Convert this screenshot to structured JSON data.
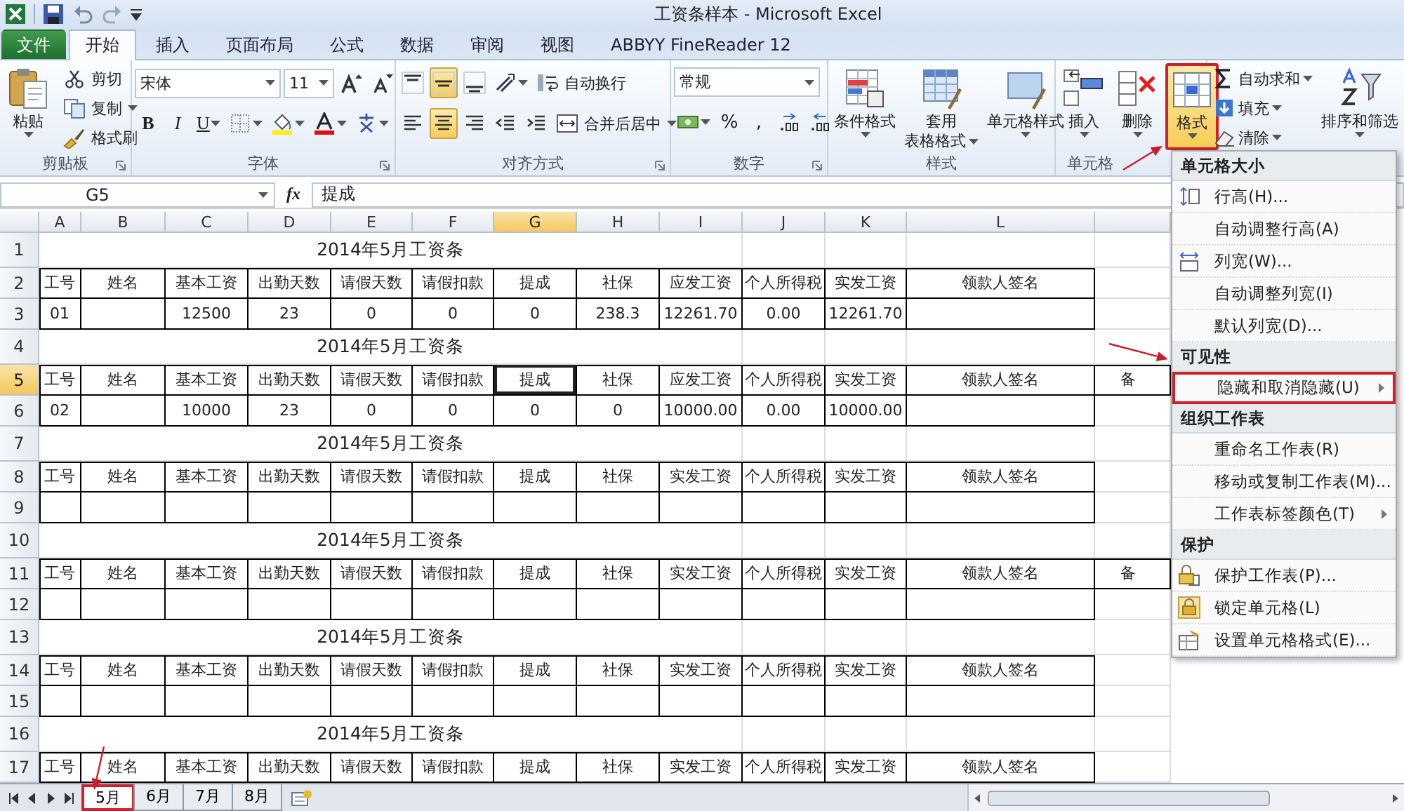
{
  "window": {
    "title": "工资条样本 - Microsoft Excel"
  },
  "ribbon_tabs": [
    {
      "label": "文件",
      "kind": "file",
      "selected": false
    },
    {
      "label": "开始",
      "kind": "tab",
      "selected": true
    },
    {
      "label": "插入",
      "kind": "tab",
      "selected": false
    },
    {
      "label": "页面布局",
      "kind": "tab",
      "selected": false
    },
    {
      "label": "公式",
      "kind": "tab",
      "selected": false
    },
    {
      "label": "数据",
      "kind": "tab",
      "selected": false
    },
    {
      "label": "审阅",
      "kind": "tab",
      "selected": false
    },
    {
      "label": "视图",
      "kind": "tab",
      "selected": false
    },
    {
      "label": "ABBYY FineReader 12",
      "kind": "tab",
      "selected": false
    }
  ],
  "ribbon": {
    "groups": [
      {
        "label": "剪贴板",
        "launcher": true,
        "items": [
          {
            "kind": "large",
            "label": [
              "粘贴"
            ],
            "caret": true
          },
          {
            "kind": "small",
            "label": "剪切"
          },
          {
            "kind": "small",
            "label": "复制",
            "caret": true
          },
          {
            "kind": "small",
            "label": "格式刷"
          }
        ]
      },
      {
        "label": "字体",
        "launcher": true,
        "rows": [
          [
            {
              "kind": "field",
              "value": "宋体"
            },
            {
              "kind": "field",
              "value": "11"
            },
            {
              "kind": "tool"
            },
            {
              "kind": "tool"
            }
          ],
          [
            {
              "kind": "bold",
              "label": "B"
            },
            {
              "kind": "italic",
              "label": "I"
            },
            {
              "kind": "underline",
              "label": "U",
              "caret": true
            },
            {
              "kind": "tool",
              "caret": true
            },
            {
              "kind": "tool",
              "caret": true
            },
            {
              "kind": "tool",
              "caret": true
            },
            {
              "kind": "tool",
              "caret": true
            }
          ]
        ]
      },
      {
        "label": "对齐方式",
        "launcher": true,
        "rows": [
          [
            {
              "kind": "tool",
              "selected": false
            },
            {
              "kind": "tool",
              "selected": true
            },
            {
              "kind": "tool",
              "selected": false
            },
            {
              "kind": "tool",
              "caret": true
            },
            {
              "kind": "small",
              "label": "自动换行"
            }
          ],
          [
            {
              "kind": "tool",
              "selected": false
            },
            {
              "kind": "tool",
              "selected": true
            },
            {
              "kind": "tool",
              "selected": false
            },
            {
              "kind": "tool"
            },
            {
              "kind": "tool"
            },
            {
              "kind": "small",
              "label": "合并后居中",
              "caret": true
            }
          ]
        ]
      },
      {
        "label": "数字",
        "launcher": true,
        "rows": [
          [
            {
              "kind": "field",
              "value": "常规"
            }
          ],
          [
            {
              "kind": "tool",
              "caret": true
            },
            {
              "kind": "tool",
              "label": "%"
            },
            {
              "kind": "tool",
              "label": ","
            },
            {
              "kind": "tool"
            },
            {
              "kind": "tool"
            }
          ]
        ]
      },
      {
        "label": "样式",
        "items": [
          {
            "kind": "large",
            "label": [
              "条件格式"
            ],
            "caret": true
          },
          {
            "kind": "large",
            "label": [
              "套用",
              "表格格式"
            ],
            "caret": true
          },
          {
            "kind": "large",
            "label": [
              "单元格样式"
            ],
            "caret": true
          }
        ]
      },
      {
        "label": "单元格",
        "items": [
          {
            "kind": "large",
            "label": [
              "插入"
            ],
            "caret": true
          },
          {
            "kind": "large",
            "label": [
              "删除"
            ],
            "caret": true
          },
          {
            "kind": "large",
            "label": [
              "格式"
            ],
            "caret": true,
            "selected": true,
            "marked": true
          }
        ]
      },
      {
        "items": [
          {
            "kind": "small",
            "label": "自动求和",
            "caret": true
          },
          {
            "kind": "small",
            "label": "填充",
            "caret": true
          },
          {
            "kind": "small",
            "label": "清除",
            "caret": true
          },
          {
            "kind": "large",
            "label": [
              "排序和筛选"
            ],
            "caret": true
          }
        ]
      }
    ]
  },
  "formula_bar": {
    "name_box": "G5",
    "function_label": "fx",
    "formula": "提成"
  },
  "grid": {
    "columns": [
      {
        "label": "A",
        "selected": false
      },
      {
        "label": "B",
        "selected": false
      },
      {
        "label": "C",
        "selected": false
      },
      {
        "label": "D",
        "selected": false
      },
      {
        "label": "E",
        "selected": false
      },
      {
        "label": "F",
        "selected": false
      },
      {
        "label": "G",
        "selected": true
      },
      {
        "label": "H",
        "selected": false
      },
      {
        "label": "I",
        "selected": false
      },
      {
        "label": "J",
        "selected": false
      },
      {
        "label": "K",
        "selected": false
      },
      {
        "label": "L",
        "selected": false
      }
    ],
    "rows": [
      {
        "number": "1",
        "kind": "title",
        "selected": false,
        "title": "2014年5月工资条"
      },
      {
        "number": "2",
        "kind": "header",
        "selected": false,
        "cells": [
          "工号",
          "姓名",
          "基本工资",
          "出勤天数",
          "请假天数",
          "请假扣款",
          "提成",
          "社保",
          "应发工资",
          "个人所得税",
          "实发工资",
          "领款人签名"
        ]
      },
      {
        "number": "3",
        "kind": "data",
        "selected": false,
        "cells": [
          "01",
          null,
          "12500",
          "23",
          "0",
          "0",
          "0",
          "238.3",
          "12261.70",
          "0.00",
          "12261.70",
          null
        ]
      },
      {
        "number": "4",
        "kind": "title",
        "selected": false,
        "title": "2014年5月工资条"
      },
      {
        "number": "5",
        "kind": "header",
        "selected": true,
        "cells": [
          "工号",
          "姓名",
          "基本工资",
          "出勤天数",
          "请假天数",
          "请假扣款",
          "提成",
          "社保",
          "应发工资",
          "个人所得税",
          "实发工资",
          "领款人签名",
          "备"
        ]
      },
      {
        "number": "6",
        "kind": "data",
        "selected": false,
        "cells": [
          "02",
          null,
          "10000",
          "23",
          "0",
          "0",
          "0",
          "0",
          "10000.00",
          "0.00",
          "10000.00",
          null
        ]
      },
      {
        "number": "7",
        "kind": "title",
        "selected": false,
        "title": "2014年5月工资条"
      },
      {
        "number": "8",
        "kind": "header",
        "selected": false,
        "cells": [
          "工号",
          "姓名",
          "基本工资",
          "出勤天数",
          "请假天数",
          "请假扣款",
          "提成",
          "社保",
          "实发工资",
          "个人所得税",
          "实发工资",
          "领款人签名"
        ]
      },
      {
        "number": "9",
        "kind": "data",
        "selected": false,
        "cells": [
          null,
          null,
          null,
          null,
          null,
          null,
          null,
          null,
          null,
          null,
          null,
          null
        ]
      },
      {
        "number": "10",
        "kind": "title",
        "selected": false,
        "title": "2014年5月工资条"
      },
      {
        "number": "11",
        "kind": "header",
        "selected": false,
        "cells": [
          "工号",
          "姓名",
          "基本工资",
          "出勤天数",
          "请假天数",
          "请假扣款",
          "提成",
          "社保",
          "实发工资",
          "个人所得税",
          "实发工资",
          "领款人签名",
          "备"
        ]
      },
      {
        "number": "12",
        "kind": "data",
        "selected": false,
        "cells": [
          null,
          null,
          null,
          null,
          null,
          null,
          null,
          null,
          null,
          null,
          null,
          null
        ]
      },
      {
        "number": "13",
        "kind": "title",
        "selected": false,
        "title": "2014年5月工资条"
      },
      {
        "number": "14",
        "kind": "header",
        "selected": false,
        "cells": [
          "工号",
          "姓名",
          "基本工资",
          "出勤天数",
          "请假天数",
          "请假扣款",
          "提成",
          "社保",
          "实发工资",
          "个人所得税",
          "实发工资",
          "领款人签名"
        ]
      },
      {
        "number": "15",
        "kind": "data",
        "selected": false,
        "cells": [
          null,
          null,
          null,
          null,
          null,
          null,
          null,
          null,
          null,
          null,
          null,
          null
        ]
      },
      {
        "number": "16",
        "kind": "title",
        "selected": false,
        "title": "2014年5月工资条"
      },
      {
        "number": "17",
        "kind": "header",
        "selected": false,
        "cells": [
          "工号",
          "姓名",
          "基本工资",
          "出勤天数",
          "请假天数",
          "请假扣款",
          "提成",
          "社保",
          "实发工资",
          "个人所得税",
          "实发工资",
          "领款人签名"
        ]
      }
    ]
  },
  "format_menu": {
    "sections": [
      {
        "title": "单元格大小",
        "items": [
          {
            "label": "行高(H)...",
            "submenu": false,
            "marked": false
          },
          {
            "label": "自动调整行高(A)",
            "submenu": false,
            "marked": false
          },
          {
            "label": "列宽(W)...",
            "submenu": false,
            "marked": false
          },
          {
            "label": "自动调整列宽(I)",
            "submenu": false,
            "marked": false
          },
          {
            "label": "默认列宽(D)...",
            "submenu": false,
            "marked": false
          }
        ]
      },
      {
        "title": "可见性",
        "items": [
          {
            "label": "隐藏和取消隐藏(U)",
            "submenu": true,
            "marked": true
          }
        ]
      },
      {
        "title": "组织工作表",
        "items": [
          {
            "label": "重命名工作表(R)",
            "submenu": false,
            "marked": false
          },
          {
            "label": "移动或复制工作表(M)...",
            "submenu": false,
            "marked": false
          },
          {
            "label": "工作表标签颜色(T)",
            "submenu": true,
            "marked": false
          }
        ]
      },
      {
        "title": "保护",
        "items": [
          {
            "label": "保护工作表(P)...",
            "submenu": false,
            "marked": false
          },
          {
            "label": "锁定单元格(L)",
            "submenu": false,
            "marked": false
          },
          {
            "label": "设置单元格格式(E)...",
            "submenu": false,
            "marked": false
          }
        ]
      }
    ]
  },
  "sheet_tabs": [
    {
      "label": "5月",
      "selected": true,
      "marked": true
    },
    {
      "label": "6月",
      "selected": false,
      "marked": false
    },
    {
      "label": "7月",
      "selected": false,
      "marked": false
    },
    {
      "label": "8月",
      "selected": false,
      "marked": false
    }
  ]
}
